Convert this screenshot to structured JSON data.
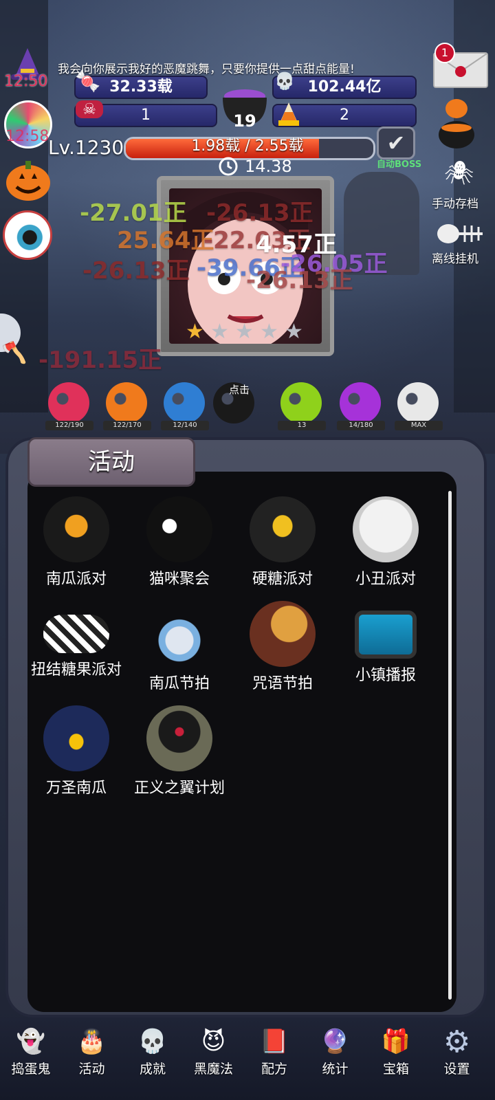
{
  "top": {
    "speech": "我会向你展示我好的恶魔跳舞，只要你提供一点甜点能量!",
    "timer_left": "12:50",
    "timer_left2": "12:58",
    "mail_badge": "1",
    "resources": {
      "candy_amount": "32.33载",
      "gem_amount": "102.44亿",
      "bow_count": "1",
      "cauldron_count": "19",
      "corn_count": "2"
    },
    "level_label": "Lv.1230",
    "level_progress_text": "1.98载 / 2.55载",
    "level_progress": 0.78,
    "countdown": "14.38",
    "auto_boss_label": "自动BOSS"
  },
  "boss": {
    "stars_filled": 1,
    "stars_total": 5
  },
  "damage_numbers": [
    {
      "text": "-27.01正",
      "color": "#b7d94a"
    },
    {
      "text": "-26.13正",
      "color": "#8b2a2a"
    },
    {
      "text": "25.64正",
      "color": "#d4742c"
    },
    {
      "text": "-22.03正",
      "color": "#9a3a3a"
    },
    {
      "text": "4.57正",
      "color": "#ffffff"
    },
    {
      "text": "-26.13正",
      "color": "#8b2a2a"
    },
    {
      "text": "-39.66正",
      "color": "#4a6ec9"
    },
    {
      "text": "-26.05正",
      "color": "#9a5ad9"
    },
    {
      "text": "-26.13正",
      "color": "#a34747"
    },
    {
      "text": "-191.15正",
      "color": "#8b2a3a"
    }
  ],
  "side_buttons": {
    "manual_save": "手动存档",
    "offline_idle": "离线挂机"
  },
  "skull_towers": [
    {
      "label": "122/190",
      "color": "#e0315a"
    },
    {
      "label": "122/170",
      "color": "#f07a1c"
    },
    {
      "label": "12/140",
      "color": "#2f7ed3"
    },
    {
      "label": "点击",
      "color": "#1a1a1a"
    },
    {
      "label": "13",
      "color": "#8fd11b"
    },
    {
      "label": "14/180",
      "color": "#a632d9"
    },
    {
      "label": "MAX",
      "color": "#e8e8e8"
    }
  ],
  "panel": {
    "title": "活动",
    "activities": [
      {
        "label": "南瓜派对",
        "icon": "pumpkin-lollipop-icon"
      },
      {
        "label": "猫咪聚会",
        "icon": "black-cat-icon"
      },
      {
        "label": "硬糖派对",
        "icon": "hard-candy-icon"
      },
      {
        "label": "小丑派对",
        "icon": "skull-lollipop-icon"
      },
      {
        "label": "扭结糖果派对",
        "icon": "twisted-candy-icon"
      },
      {
        "label": "南瓜节拍",
        "icon": "headphones-icon"
      },
      {
        "label": "咒语节拍",
        "icon": "gramophone-icon"
      },
      {
        "label": "小镇播报",
        "icon": "tv-icon"
      },
      {
        "label": "万圣南瓜",
        "icon": "jack-o-lantern-icon"
      },
      {
        "label": "正义之翼计划",
        "icon": "bat-lantern-icon"
      }
    ]
  },
  "nav": [
    {
      "label": "捣蛋鬼",
      "icon": "ghost-icon"
    },
    {
      "label": "活动",
      "icon": "cake-icon"
    },
    {
      "label": "成就",
      "icon": "skull-trophy-icon"
    },
    {
      "label": "黑魔法",
      "icon": "devil-icon"
    },
    {
      "label": "配方",
      "icon": "spellbook-icon"
    },
    {
      "label": "统计",
      "icon": "crystal-ball-icon"
    },
    {
      "label": "宝箱",
      "icon": "gift-box-icon"
    },
    {
      "label": "设置",
      "icon": "gear-icon"
    }
  ]
}
